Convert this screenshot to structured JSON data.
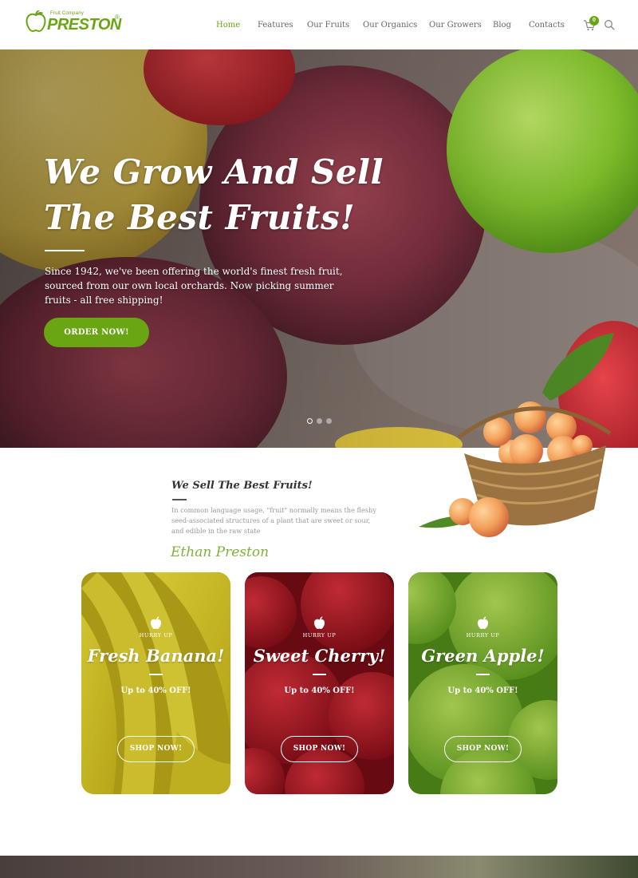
{
  "brand": {
    "tagline": "Fruit Company",
    "name": "PRESTON",
    "registered": "®",
    "accent": "#6aa513"
  },
  "nav": {
    "items": [
      {
        "label": "Home",
        "active": true
      },
      {
        "label": "Features",
        "active": false
      },
      {
        "label": "Our Fruits",
        "active": false
      },
      {
        "label": "Our Organics",
        "active": false
      },
      {
        "label": "Our Growers",
        "active": false
      },
      {
        "label": "Blog",
        "active": false
      },
      {
        "label": "Contacts",
        "active": false
      }
    ],
    "cart_count": "0",
    "cart_icon": "cart-icon",
    "search_icon": "search-icon"
  },
  "hero": {
    "title_line1": "We Grow And Sell",
    "title_line2": "The Best Fruits!",
    "text": "Since 1942, we've been offering the world's finest fresh fruit, sourced from our own local orchards. Now picking summer fruits - all free shipping!",
    "button": "ORDER NOW!",
    "slides": 3,
    "active_slide": 1
  },
  "intro": {
    "title": "We Sell The Best Fruits!",
    "text": "In common language usage, \"fruit\" normally means the fleshy seed-associated structures of a plant that are sweet or sour, and edible in the raw state",
    "signature": "Ethan Preston"
  },
  "promos": [
    {
      "kicker": "HURRY UP",
      "title": "Fresh Banana!",
      "offer": "Up to 40% OFF!",
      "button": "SHOP NOW!",
      "icon": "apple-icon"
    },
    {
      "kicker": "HURRY UP",
      "title": "Sweet Cherry!",
      "offer": "Up to 40% OFF!",
      "button": "SHOP NOW!",
      "icon": "apple-icon"
    },
    {
      "kicker": "HURRY UP",
      "title": "Green Apple!",
      "offer": "Up to 40% OFF!",
      "button": "SHOP NOW!",
      "icon": "apple-icon"
    }
  ]
}
